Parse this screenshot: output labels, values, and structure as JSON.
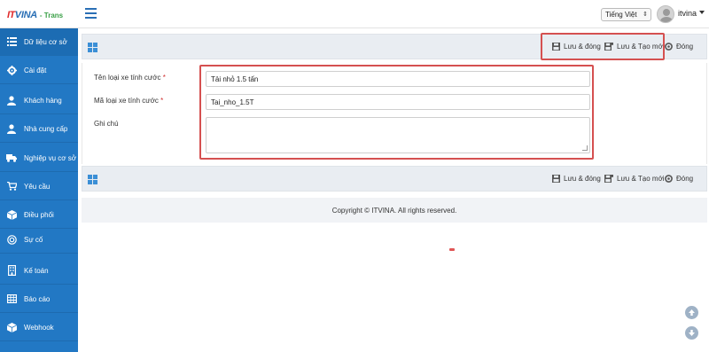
{
  "header": {
    "logo_it": "IT",
    "logo_vina": "VINA",
    "logo_suffix": "- Trans",
    "language": "Tiếng Việt",
    "user": "itvina"
  },
  "sidebar": {
    "items": [
      {
        "label": "Dữ liệu cơ sở",
        "icon": "list-icon"
      },
      {
        "label": "Cài đặt",
        "icon": "gear-icon"
      },
      {
        "label": "Khách hàng",
        "icon": "user-icon"
      },
      {
        "label": "Nhà cung cấp",
        "icon": "user-icon"
      },
      {
        "label": "Nghiệp vụ cơ sở",
        "icon": "truck-icon"
      },
      {
        "label": "Yêu cầu",
        "icon": "cart-icon"
      },
      {
        "label": "Điều phối",
        "icon": "cube-icon"
      },
      {
        "label": "Sự cố",
        "icon": "target-icon"
      },
      {
        "label": "Kế toán",
        "icon": "building-icon"
      },
      {
        "label": "Báo cáo",
        "icon": "table-icon"
      },
      {
        "label": "Webhook",
        "icon": "cube-icon"
      }
    ]
  },
  "toolbar": {
    "save_close": "Lưu & đóng",
    "save_new": "Lưu & Tạo mới",
    "close": "Đóng"
  },
  "form": {
    "name_label": "Tên loại xe tính cước",
    "name_value": "Tải nhỏ 1.5 tấn",
    "code_label": "Mã loại xe tính cước",
    "code_value": "Tai_nho_1.5T",
    "note_label": "Ghi chú",
    "note_value": "",
    "required_mark": "*"
  },
  "footer": {
    "copyright": "Copyright © ITVINA. All rights reserved."
  },
  "colors": {
    "sidebar": "#2278c4",
    "accent": "#2a6fb5",
    "highlight": "#d55050"
  }
}
